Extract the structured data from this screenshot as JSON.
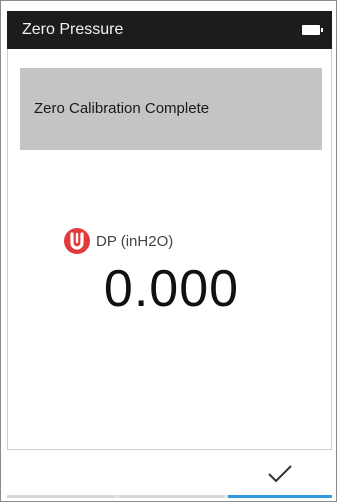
{
  "header": {
    "title": "Zero Pressure",
    "battery_icon": "battery-icon"
  },
  "banner": {
    "message": "Zero Calibration Complete"
  },
  "measurement": {
    "icon": "brand-logo-icon",
    "label": "DP (inH2O)",
    "value": "0.000"
  },
  "footer": {
    "confirm_icon": "checkmark-icon",
    "accent_color": "#2f9ae0"
  },
  "colors": {
    "header_bg": "#1c1c1c",
    "banner_bg": "#c4c4c4",
    "brand_red": "#e23a3a"
  }
}
